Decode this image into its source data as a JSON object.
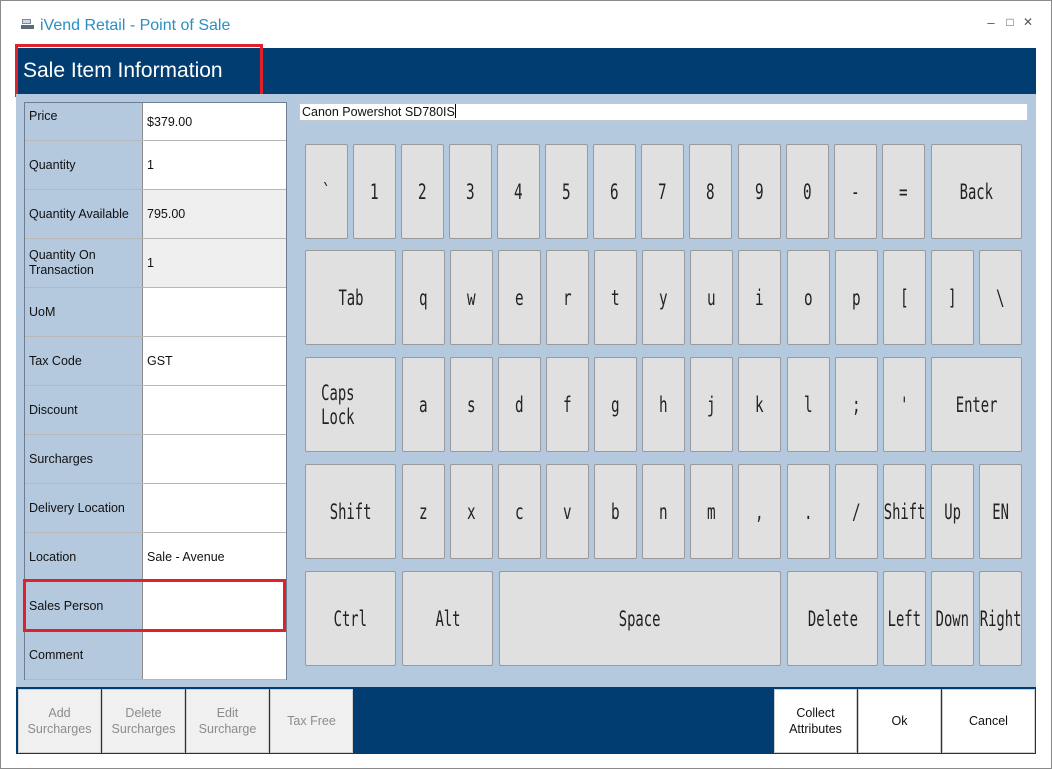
{
  "window": {
    "app_title": "iVend Retail - Point of Sale",
    "minimize_glyph": "–",
    "maximize_glyph": "□",
    "close_glyph": "✕",
    "app_icon": "pos-terminal-icon"
  },
  "header": {
    "title": "Sale Item Information"
  },
  "colors": {
    "header_band": "#023d72",
    "panel": "#b4c8de",
    "highlight": "#e0202b",
    "title_text": "#2a8fc2",
    "key": "#e0e0e0"
  },
  "item_info": {
    "rows": [
      {
        "label": "Price",
        "value": "$379.00",
        "readonly": false
      },
      {
        "label": "Quantity",
        "value": "1",
        "readonly": false
      },
      {
        "label": "Quantity Available",
        "value": "795.00",
        "readonly": true
      },
      {
        "label": "Quantity On Transaction",
        "value": "1",
        "readonly": true
      },
      {
        "label": "UoM",
        "value": "",
        "readonly": false
      },
      {
        "label": "Tax Code",
        "value": "GST",
        "readonly": false
      },
      {
        "label": "Discount",
        "value": "",
        "readonly": false
      },
      {
        "label": "Surcharges",
        "value": "",
        "readonly": false
      },
      {
        "label": "Delivery Location",
        "value": "",
        "readonly": false
      },
      {
        "label": "Location",
        "value": "Sale - Avenue",
        "readonly": false
      },
      {
        "label": "Sales Person",
        "value": "",
        "readonly": false
      },
      {
        "label": "Comment",
        "value": "",
        "readonly": false
      }
    ]
  },
  "input": {
    "value": "Canon Powershot SD780IS"
  },
  "keyboard": {
    "rows": [
      [
        "`",
        "1",
        "2",
        "3",
        "4",
        "5",
        "6",
        "7",
        "8",
        "9",
        "0",
        "-",
        "=",
        "Back"
      ],
      [
        "Tab",
        "q",
        "w",
        "e",
        "r",
        "t",
        "y",
        "u",
        "i",
        "o",
        "p",
        "[",
        "]",
        "\\"
      ],
      [
        "Caps Lock",
        "a",
        "s",
        "d",
        "f",
        "g",
        "h",
        "j",
        "k",
        "l",
        ";",
        "'",
        "Enter"
      ],
      [
        "Shift",
        "z",
        "x",
        "c",
        "v",
        "b",
        "n",
        "m",
        ",",
        ".",
        "/",
        "Shift",
        "Up",
        "EN"
      ],
      [
        "Ctrl",
        "Alt",
        "Space",
        "Delete",
        "Left",
        "Down",
        "Right"
      ]
    ]
  },
  "footer": {
    "buttons": [
      {
        "label": "Add\nSurcharges",
        "enabled": false
      },
      {
        "label": "Delete\nSurcharges",
        "enabled": false
      },
      {
        "label": "Edit\nSurcharge",
        "enabled": false
      },
      {
        "label": "Tax Free",
        "enabled": false
      },
      {
        "label": "Collect\nAttributes",
        "enabled": true
      },
      {
        "label": "Ok",
        "enabled": true
      },
      {
        "label": "Cancel",
        "enabled": true
      }
    ]
  }
}
